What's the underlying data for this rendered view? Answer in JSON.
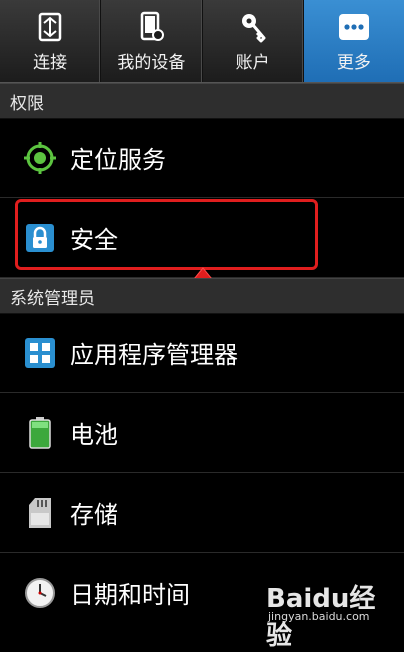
{
  "tabs": [
    {
      "label": "连接",
      "icon": "connections-icon",
      "active": false
    },
    {
      "label": "我的设备",
      "icon": "my-device-icon",
      "active": false
    },
    {
      "label": "账户",
      "icon": "accounts-key-icon",
      "active": false
    },
    {
      "label": "更多",
      "icon": "more-icon",
      "active": true
    }
  ],
  "sections": {
    "permissions": "权限",
    "device_admin": "系统管理员"
  },
  "items": [
    {
      "label": "定位服务",
      "icon": "location-icon"
    },
    {
      "label": "安全",
      "icon": "lock-icon"
    },
    {
      "label": "应用程序管理器",
      "icon": "app-grid-icon"
    },
    {
      "label": "电池",
      "icon": "battery-icon"
    },
    {
      "label": "存储",
      "icon": "sd-card-icon"
    },
    {
      "label": "日期和时间",
      "icon": "clock-icon"
    }
  ],
  "colors": {
    "active_tab": "#2a7fc9",
    "highlight": "#e01e1e"
  },
  "watermark": {
    "logo": "Baidu经验",
    "url": "jingyan.baidu.com"
  }
}
